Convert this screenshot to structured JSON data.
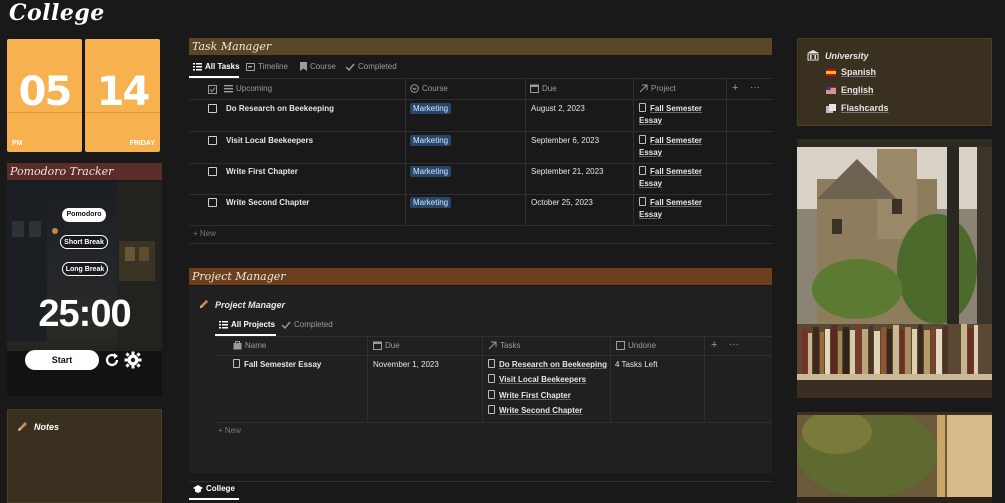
{
  "page": {
    "title": "College"
  },
  "clock": {
    "hour": "05",
    "minute": "14",
    "ampm": "PM",
    "day": "FRIDAY"
  },
  "pomodoro": {
    "title": "Pomodoro Tracker",
    "modes": [
      "Pomodoro",
      "Short Break",
      "Long Break"
    ],
    "timer": "25:00",
    "start_label": "Start"
  },
  "notes": {
    "title": "Notes"
  },
  "task_manager": {
    "title": "Task Manager",
    "tabs": [
      {
        "label": "All Tasks",
        "icon": "list-icon"
      },
      {
        "label": "Timeline",
        "icon": "timeline-icon"
      },
      {
        "label": "Course",
        "icon": "bookmark-icon"
      },
      {
        "label": "Completed",
        "icon": "check-icon"
      }
    ],
    "columns": [
      "Upcoming",
      "Course",
      "Due",
      "Project"
    ],
    "rows": [
      {
        "task": "Do Research on Beekeeping",
        "course": "Marketing",
        "due": "August 2, 2023",
        "project_l1": "Fall Semester",
        "project_l2": "Essay"
      },
      {
        "task": "Visit Local Beekeepers",
        "course": "Marketing",
        "due": "September 6, 2023",
        "project_l1": "Fall Semester",
        "project_l2": "Essay"
      },
      {
        "task": "Write First Chapter",
        "course": "Marketing",
        "due": "September 21, 2023",
        "project_l1": "Fall Semester",
        "project_l2": "Essay"
      },
      {
        "task": "Write Second Chapter",
        "course": "Marketing",
        "due": "October 25, 2023",
        "project_l1": "Fall Semester",
        "project_l2": "Essay"
      }
    ],
    "new_label": "New"
  },
  "project_manager": {
    "title": "Project Manager",
    "db_title": "Project Manager",
    "tabs": [
      {
        "label": "All Projects",
        "icon": "list-icon"
      },
      {
        "label": "Completed",
        "icon": "check-icon"
      }
    ],
    "columns": [
      "Name",
      "Due",
      "Tasks",
      "Undone"
    ],
    "rows": [
      {
        "name": "Fall Semester Essay",
        "due": "November 1, 2023",
        "tasks": [
          "Do Research on Beekeeping",
          "Visit Local Beekeepers",
          "Write First Chapter",
          "Write Second Chapter"
        ],
        "undone": "4 Tasks Left"
      }
    ],
    "new_label": "New"
  },
  "bottom": {
    "tab_label": "College"
  },
  "university": {
    "title": "University",
    "links": [
      {
        "label": "Spanish",
        "icon": "spain-flag-icon"
      },
      {
        "label": "English",
        "icon": "us-flag-icon"
      },
      {
        "label": "Flashcards",
        "icon": "cards-icon"
      }
    ]
  },
  "colors": {
    "accent_orange": "#f7b24f",
    "tag_blue": "#28456c",
    "task_header": "#5a4526",
    "project_header": "#6b3f1e",
    "pomodoro_header": "#5a2d2b",
    "card_brown": "#3a3020"
  }
}
